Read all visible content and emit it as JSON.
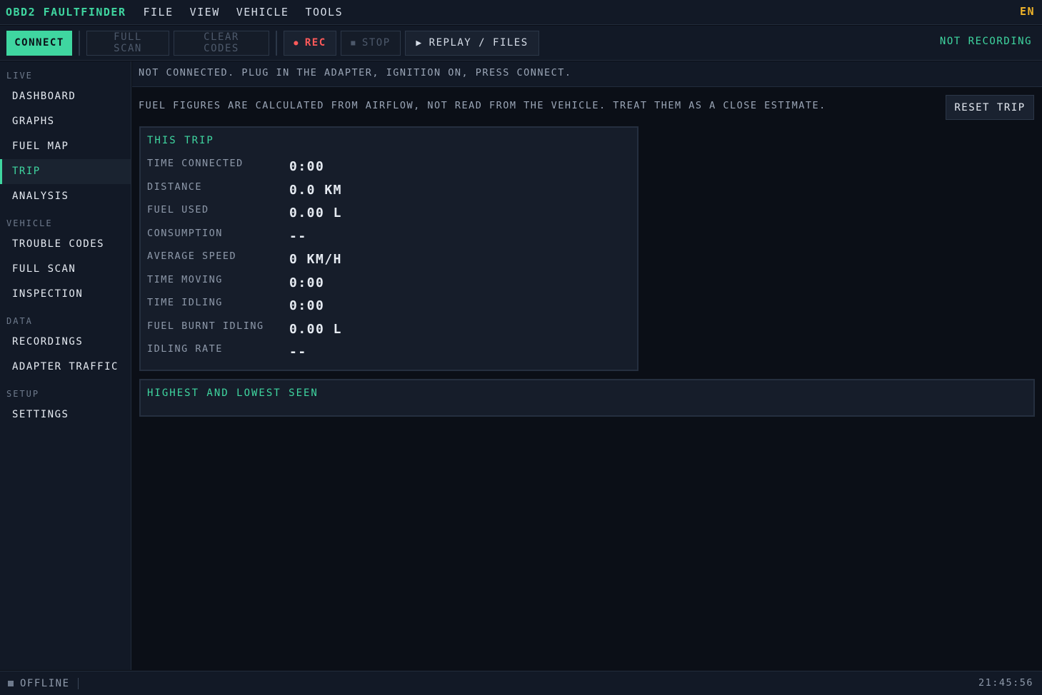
{
  "menubar": {
    "title": "OBD2 FAULTFINDER",
    "items": [
      "FILE",
      "VIEW",
      "VEHICLE",
      "TOOLS"
    ],
    "language": "EN"
  },
  "toolbar": {
    "connect": "CONNECT",
    "full_scan": "FULL SCAN",
    "clear_codes": "CLEAR CODES",
    "rec": "REC",
    "stop": "STOP",
    "replay": "REPLAY / FILES",
    "recording_status": "NOT RECORDING"
  },
  "sidebar": {
    "sections": [
      {
        "label": "LIVE",
        "items": [
          "DASHBOARD",
          "GRAPHS",
          "FUEL MAP",
          "TRIP",
          "ANALYSIS"
        ]
      },
      {
        "label": "VEHICLE",
        "items": [
          "TROUBLE CODES",
          "FULL SCAN",
          "INSPECTION"
        ]
      },
      {
        "label": "DATA",
        "items": [
          "RECORDINGS",
          "ADAPTER TRAFFIC"
        ]
      },
      {
        "label": "SETUP",
        "items": [
          "SETTINGS"
        ]
      }
    ],
    "active": "TRIP"
  },
  "main": {
    "notice": "NOT CONNECTED. PLUG IN THE ADAPTER, IGNITION ON, PRESS CONNECT.",
    "fuel_note": "FUEL FIGURES ARE CALCULATED FROM AIRFLOW, NOT READ FROM THE VEHICLE. TREAT THEM AS A CLOSE ESTIMATE.",
    "reset_trip": "RESET TRIP",
    "trip": {
      "title": "THIS TRIP",
      "rows": [
        {
          "label": "TIME CONNECTED",
          "value": "0:00"
        },
        {
          "label": "DISTANCE",
          "value": "0.0 KM"
        },
        {
          "label": "FUEL USED",
          "value": "0.00 L"
        },
        {
          "label": "CONSUMPTION",
          "value": "--"
        },
        {
          "label": "AVERAGE SPEED",
          "value": "0 KM/H"
        },
        {
          "label": "TIME MOVING",
          "value": "0:00"
        },
        {
          "label": "TIME IDLING",
          "value": "0:00"
        },
        {
          "label": "FUEL BURNT IDLING",
          "value": "0.00 L"
        },
        {
          "label": "IDLING RATE",
          "value": "--"
        }
      ]
    },
    "extremes": {
      "title": "HIGHEST AND LOWEST SEEN"
    }
  },
  "statusbar": {
    "state": "OFFLINE",
    "clock": "21:45:56"
  }
}
